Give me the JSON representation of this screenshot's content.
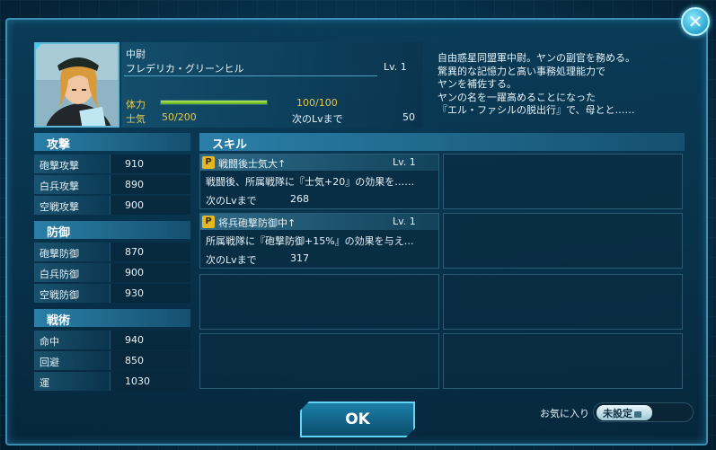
{
  "character": {
    "rank": "中尉",
    "name": "フレデリカ・グリーンヒル",
    "level": "Lv.  1",
    "hp_label": "体力",
    "hp_value": "100/100",
    "hp_fraction": 1.0,
    "morale_label": "士気",
    "morale_value": "50/200",
    "next_label": "次のLvまで",
    "next_value": "50",
    "description": "自由惑星同盟軍中尉。ヤンの副官を務める。\n驚異的な記憶力と高い事務処理能力で\nヤンを補佐する。\nヤンの名を一躍高めることになった\n『エル・ファシルの脱出行』で、母とと……"
  },
  "stats": {
    "attack": {
      "header": "攻撃",
      "rows": [
        {
          "name": "砲撃攻撃",
          "value": "910"
        },
        {
          "name": "白兵攻撃",
          "value": "890"
        },
        {
          "name": "空戦攻撃",
          "value": "900"
        }
      ]
    },
    "defense": {
      "header": "防御",
      "rows": [
        {
          "name": "砲撃防御",
          "value": "870"
        },
        {
          "name": "白兵防御",
          "value": "900"
        },
        {
          "name": "空戦防御",
          "value": "930"
        }
      ]
    },
    "tactics": {
      "header": "戦術",
      "rows": [
        {
          "name": "命中",
          "value": "940"
        },
        {
          "name": "回避",
          "value": "850"
        },
        {
          "name": "運",
          "value": "1030"
        }
      ]
    }
  },
  "skills": {
    "header": "スキル",
    "items": [
      {
        "badge": "P",
        "name": "戦闘後士気大↑",
        "level": "Lv.  1",
        "desc": "戦闘後、所属戦隊に『士気+20』の効果を……",
        "next_label": "次のLvまで",
        "next_value": "268"
      },
      {
        "badge": "P",
        "name": "将兵砲撃防御中↑",
        "level": "Lv.  1",
        "desc": "所属戦隊に『砲撃防御+15%』の効果を与え…",
        "next_label": "次のLvまで",
        "next_value": "317"
      }
    ]
  },
  "buttons": {
    "ok": "OK",
    "close": "✕"
  },
  "favorite": {
    "label": "お気に入り",
    "state": "未設定"
  },
  "colors": {
    "accent": "#5fd4f3",
    "label_yellow": "#e7c84a",
    "hp_green": "#8fd03a",
    "badge": "#e7b623"
  }
}
